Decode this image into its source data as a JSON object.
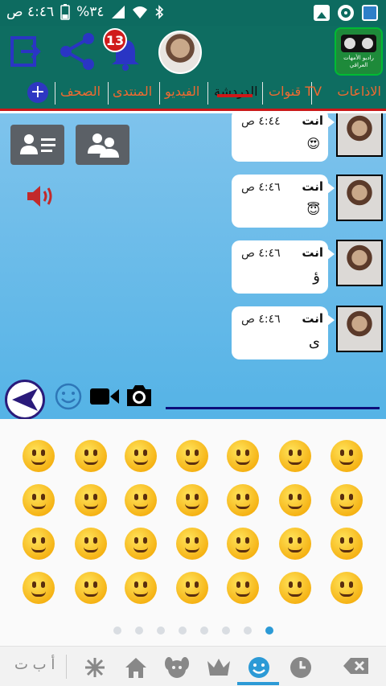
{
  "status_bar": {
    "clock": "٤:٤٦ ص",
    "battery": "%٣٤"
  },
  "header": {
    "notification_count": "13",
    "logo_text": "راديو الأمهات العراقي"
  },
  "tabs": [
    {
      "label": "الاذاعات",
      "active": false
    },
    {
      "label": "قنوات TV",
      "active": false
    },
    {
      "label": "الدردشة",
      "active": true
    },
    {
      "label": "الفيديو",
      "active": false
    },
    {
      "label": "المنتدى",
      "active": false
    },
    {
      "label": "الصحف",
      "active": false
    }
  ],
  "messages": [
    {
      "sender": "انت",
      "time": "٤:٤٤ ص",
      "text": "😍"
    },
    {
      "sender": "انت",
      "time": "٤:٤٦ ص",
      "text": "😇"
    },
    {
      "sender": "انت",
      "time": "٤:٤٦ ص",
      "text": "ؤ"
    },
    {
      "sender": "انت",
      "time": "٤:٤٦ ص",
      "text": "ى"
    }
  ],
  "keyboard": {
    "abc_label": "أ ب ت",
    "selected_category": "smileys",
    "page_index": 7,
    "page_count": 8
  },
  "colors": {
    "header_bg": "#0e6d61",
    "tab_inactive": "#f06a30",
    "chat_bg": "#63b8e8",
    "accent_blue": "#2c9ad6",
    "badge_red": "#d01c1c"
  }
}
